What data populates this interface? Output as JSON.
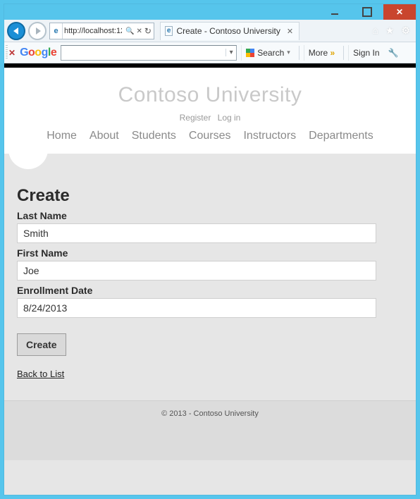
{
  "browser": {
    "url": "http://localhost:12",
    "tab_title": "Create - Contoso University",
    "search_label": "Search",
    "more_label": "More",
    "signin_label": "Sign In",
    "google_label": "Google"
  },
  "site": {
    "title": "Contoso University",
    "account_links": {
      "register": "Register",
      "login": "Log in"
    },
    "nav": {
      "home": "Home",
      "about": "About",
      "students": "Students",
      "courses": "Courses",
      "instructors": "Instructors",
      "departments": "Departments"
    }
  },
  "form": {
    "heading": "Create",
    "last_name_label": "Last Name",
    "last_name_value": "Smith",
    "first_name_label": "First Name",
    "first_name_value": "Joe",
    "enroll_label": "Enrollment Date",
    "enroll_value": "8/24/2013",
    "submit_label": "Create",
    "back_label": "Back to List"
  },
  "footer": {
    "text": "© 2013 - Contoso University"
  }
}
